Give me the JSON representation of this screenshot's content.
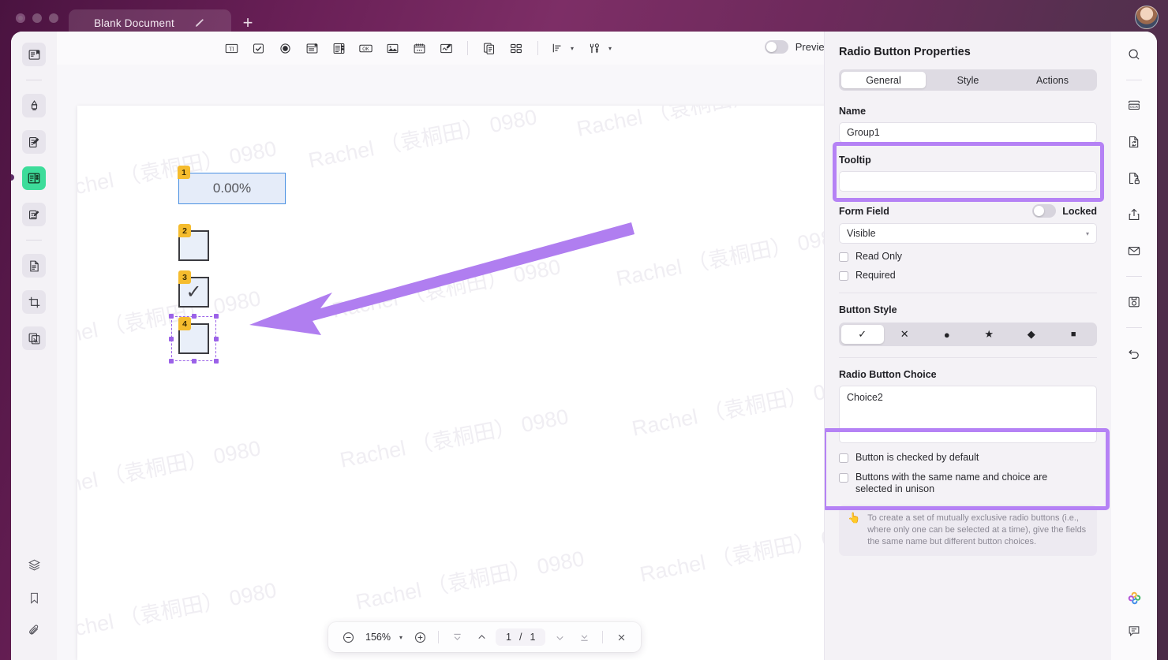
{
  "window": {
    "tab_title": "Blank Document",
    "tab_edit_icon": "pencil-icon",
    "new_tab_icon": "plus-icon",
    "traffic_lights": [
      "close",
      "minimize",
      "maximize"
    ],
    "avatar": "user-avatar"
  },
  "toolbar": {
    "tools": [
      {
        "name": "text-field-tool",
        "glyph": "TI"
      },
      {
        "name": "checkbox-tool",
        "glyph": "checkbox"
      },
      {
        "name": "radio-button-tool",
        "glyph": "radio"
      },
      {
        "name": "combo-box-tool",
        "glyph": "combo"
      },
      {
        "name": "list-box-tool",
        "glyph": "list"
      },
      {
        "name": "push-button-tool",
        "glyph": "OK"
      },
      {
        "name": "image-field-tool",
        "glyph": "image"
      },
      {
        "name": "date-field-tool",
        "glyph": "date"
      },
      {
        "name": "signature-field-tool",
        "glyph": "signature"
      }
    ],
    "extra": [
      {
        "name": "duplicate-page-tool",
        "glyph": "pages"
      },
      {
        "name": "grid-layout-tool",
        "glyph": "grid"
      }
    ],
    "align_tool": {
      "name": "align-tool",
      "glyph": "align",
      "caret": "▾"
    },
    "form_tool": {
      "name": "form-settings-tool",
      "glyph": "wrench",
      "caret": "▾"
    },
    "preview_label": "Preview",
    "preview_on": false
  },
  "left_rail": {
    "items": [
      {
        "name": "sidebar-item-reader",
        "icon": "book-open-icon",
        "active": false
      },
      {
        "name": "sidebar-item-highlight",
        "icon": "highlighter-icon",
        "active": false
      },
      {
        "name": "sidebar-item-edit",
        "icon": "edit-document-icon",
        "active": false
      },
      {
        "name": "sidebar-item-form",
        "icon": "form-fields-icon",
        "active": true
      },
      {
        "name": "sidebar-item-sign",
        "icon": "sign-document-icon",
        "active": false
      },
      {
        "name": "sidebar-item-page",
        "icon": "page-icon",
        "active": false
      },
      {
        "name": "sidebar-item-crop",
        "icon": "crop-icon",
        "active": false
      },
      {
        "name": "sidebar-item-compare",
        "icon": "compare-icon",
        "active": false
      }
    ],
    "bottom_items": [
      {
        "name": "sidebar-item-layers",
        "icon": "layers-icon"
      },
      {
        "name": "sidebar-item-bookmarks",
        "icon": "bookmark-icon"
      },
      {
        "name": "sidebar-item-attachments",
        "icon": "paperclip-icon"
      }
    ]
  },
  "right_rail": {
    "items": [
      {
        "name": "search-button",
        "icon": "search-icon"
      },
      {
        "name": "ocr-button",
        "icon": "ocr-icon"
      },
      {
        "name": "convert-button",
        "icon": "convert-file-icon"
      },
      {
        "name": "protect-button",
        "icon": "file-lock-icon"
      },
      {
        "name": "share-button",
        "icon": "share-icon"
      },
      {
        "name": "email-button",
        "icon": "envelope-icon"
      },
      {
        "name": "save-snapshot-button",
        "icon": "camera-save-icon"
      },
      {
        "name": "undo-button",
        "icon": "undo-icon"
      }
    ],
    "bottom_items": [
      {
        "name": "ai-assistant-button",
        "icon": "ai-flower-icon"
      },
      {
        "name": "comments-button",
        "icon": "comment-icon"
      }
    ]
  },
  "canvas": {
    "watermark_text": "Rachel （袁桐田）  0980",
    "fields": [
      {
        "name": "text-field-1",
        "badge": "1",
        "value": "0.00%",
        "type": "text"
      },
      {
        "name": "checkbox-field-2",
        "badge": "2",
        "value": "",
        "type": "checkbox"
      },
      {
        "name": "checkbox-field-3",
        "badge": "3",
        "value": "✓",
        "type": "checkbox"
      },
      {
        "name": "radio-field-4",
        "badge": "4",
        "value": "",
        "type": "radio",
        "selected": true
      }
    ],
    "annotation_arrow": {
      "name": "annotation-arrow",
      "color": "#b07ef0",
      "direction": "left"
    }
  },
  "bottom_bar": {
    "zoom_out_icon": "minus-circle-icon",
    "zoom_value": "156%",
    "zoom_caret": "▾",
    "zoom_in_icon": "plus-circle-icon",
    "first_page_icon": "first-page-icon",
    "prev_page_icon": "prev-page-icon",
    "current_page": "1",
    "page_separator": "/",
    "total_pages": "1",
    "next_page_icon": "next-page-icon",
    "last_page_icon": "last-page-icon",
    "close_icon": "close-icon"
  },
  "properties": {
    "title": "Radio Button Properties",
    "tabs": [
      {
        "name": "tab-general",
        "label": "General",
        "active": true
      },
      {
        "name": "tab-style",
        "label": "Style",
        "active": false
      },
      {
        "name": "tab-actions",
        "label": "Actions",
        "active": false
      }
    ],
    "name_label": "Name",
    "name_value": "Group1",
    "tooltip_label": "Tooltip",
    "tooltip_value": "",
    "form_field_label": "Form Field",
    "locked_label": "Locked",
    "locked_on": false,
    "visibility_value": "Visible",
    "visibility_caret": "▾",
    "read_only_label": "Read Only",
    "read_only_checked": false,
    "required_label": "Required",
    "required_checked": false,
    "button_style_label": "Button Style",
    "button_styles": [
      {
        "name": "style-check",
        "glyph": "✓",
        "active": true
      },
      {
        "name": "style-cross",
        "glyph": "✕",
        "active": false
      },
      {
        "name": "style-circle",
        "glyph": "●",
        "active": false
      },
      {
        "name": "style-star",
        "glyph": "★",
        "active": false
      },
      {
        "name": "style-diamond",
        "glyph": "◆",
        "active": false
      },
      {
        "name": "style-square",
        "glyph": "■",
        "active": false
      }
    ],
    "choice_label": "Radio Button Choice",
    "choice_value": "Choice2",
    "checked_default_label": "Button is checked by default",
    "checked_default_checked": false,
    "unison_label": "Buttons with the same name and choice are selected in unison",
    "unison_checked": false,
    "tip_icon": "hand-point-icon",
    "tip_text": "To create a set of mutually exclusive radio buttons (i.e., where only one can be selected at a time), give the fields the same name but different button choices."
  },
  "colors": {
    "accent_green": "#3ddc9a",
    "annotation_purple": "#b582f5",
    "badge_yellow": "#f5bc2e",
    "field_blue": "#4a90e2"
  }
}
